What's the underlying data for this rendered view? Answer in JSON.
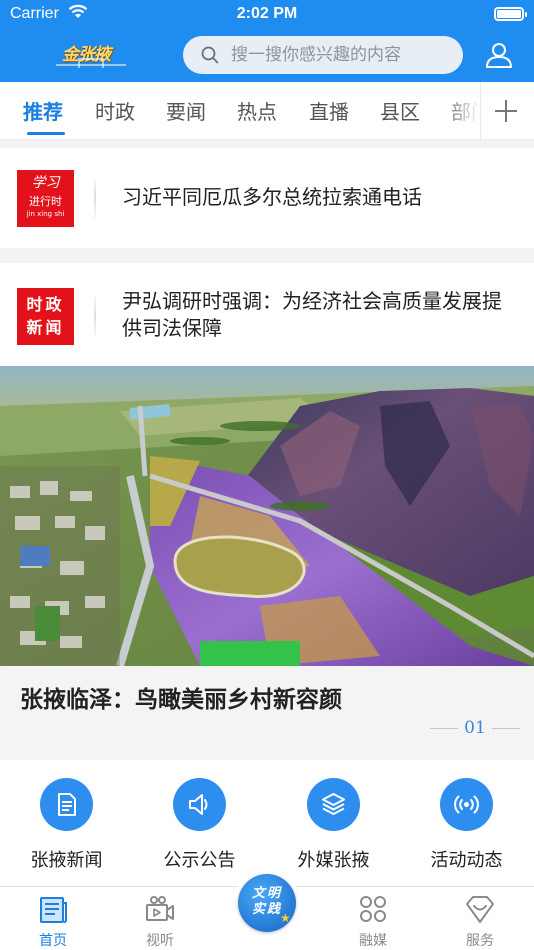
{
  "status_bar": {
    "carrier": "Carrier",
    "time": "2:02 PM"
  },
  "header": {
    "logo_text": "金张掖",
    "search_placeholder": "搜一搜你感兴趣的内容",
    "accent_color": "#1f8cf0"
  },
  "tabs": [
    {
      "label": "推荐",
      "active": true
    },
    {
      "label": "时政"
    },
    {
      "label": "要闻"
    },
    {
      "label": "热点"
    },
    {
      "label": "直播"
    },
    {
      "label": "县区"
    },
    {
      "label": "部门"
    }
  ],
  "news": [
    {
      "badge_top": "学习",
      "badge_mid": "进行时",
      "badge_bottom": "jin xing shi",
      "title": "习近平同厄瓜多尔总统拉索通电话"
    },
    {
      "badge_line1": "时政",
      "badge_line2": "新闻",
      "title": "尹弘调研时强调：为经济社会高质量发展提供司法保障"
    }
  ],
  "hero": {
    "caption": "张掖临泽：鸟瞰美丽乡村新容颜",
    "page": "01"
  },
  "quick_links": [
    {
      "label": "张掖新闻",
      "icon": "document-icon"
    },
    {
      "label": "公示公告",
      "icon": "speaker-icon"
    },
    {
      "label": "外媒张掖",
      "icon": "layers-icon"
    },
    {
      "label": "活动动态",
      "icon": "broadcast-icon"
    }
  ],
  "bottom_nav": [
    {
      "label": "首页",
      "icon": "news-home-icon",
      "active": true
    },
    {
      "label": "视听",
      "icon": "video-icon"
    },
    {
      "label": "融媒",
      "icon": "grid-icon"
    },
    {
      "label": "服务",
      "icon": "service-icon"
    }
  ],
  "center_button": {
    "line1": "文明",
    "line2": "实践"
  }
}
